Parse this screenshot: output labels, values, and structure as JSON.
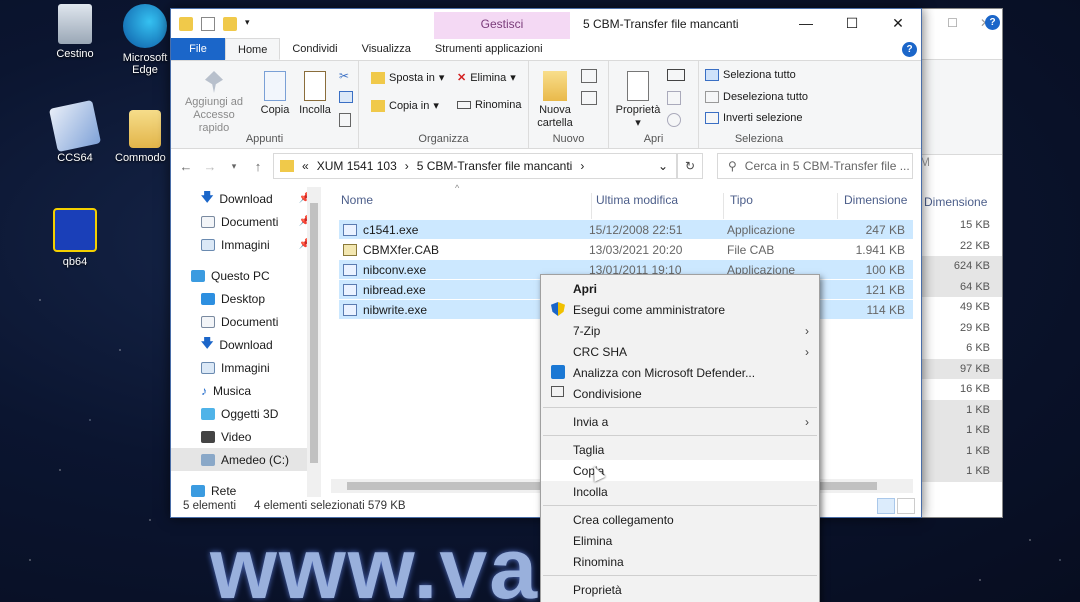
{
  "desktop": {
    "icons": [
      {
        "label": "Cestino"
      },
      {
        "label": "Microsoft Edge"
      },
      {
        "label": "CCS64"
      },
      {
        "label": "Commodo"
      },
      {
        "label": "qb64"
      }
    ],
    "watermark": "www.va          .it"
  },
  "window": {
    "title": "5 CBM-Transfer file mancanti",
    "context_tab": "Gestisci",
    "controls": {
      "minimize": "—",
      "maximize": "☐",
      "close": "✕"
    },
    "tabs": [
      "File",
      "Home",
      "Condividi",
      "Visualizza",
      "Strumenti applicazioni"
    ],
    "active_tab": "Home"
  },
  "ribbon": {
    "appunti": {
      "label": "Appunti",
      "pin": "Aggiungi ad Accesso rapido",
      "copy": "Copia",
      "paste": "Incolla"
    },
    "organizza": {
      "label": "Organizza",
      "move": "Sposta in",
      "copy_to": "Copia in",
      "delete": "Elimina",
      "rename": "Rinomina"
    },
    "nuovo": {
      "label": "Nuovo",
      "new_folder": "Nuova cartella"
    },
    "apri": {
      "label": "Apri",
      "properties": "Proprietà"
    },
    "seleziona": {
      "label": "Seleziona",
      "select_all": "Seleziona tutto",
      "deselect_all": "Deseleziona tutto",
      "invert": "Inverti selezione"
    }
  },
  "address": {
    "prefix": "«",
    "crumbs": [
      "XUM 1541 103",
      "5 CBM-Transfer file mancanti"
    ],
    "search_placeholder": "Cerca in 5 CBM-Transfer file ..."
  },
  "nav": {
    "items": [
      {
        "label": "Download",
        "pinned": true
      },
      {
        "label": "Documenti",
        "pinned": true
      },
      {
        "label": "Immagini",
        "pinned": true
      },
      {
        "label": "Questo PC"
      },
      {
        "label": "Desktop"
      },
      {
        "label": "Documenti"
      },
      {
        "label": "Download"
      },
      {
        "label": "Immagini"
      },
      {
        "label": "Musica"
      },
      {
        "label": "Oggetti 3D"
      },
      {
        "label": "Video"
      },
      {
        "label": "Amedeo (C:)"
      },
      {
        "label": "Rete"
      }
    ]
  },
  "columns": {
    "name": "Nome",
    "modified": "Ultima modifica",
    "type": "Tipo",
    "size": "Dimensione"
  },
  "files": [
    {
      "name": "c1541.exe",
      "modified": "15/12/2008 22:51",
      "type": "Applicazione",
      "size": "247 KB",
      "selected": true
    },
    {
      "name": "CBMXfer.CAB",
      "modified": "13/03/2021 20:20",
      "type": "File CAB",
      "size": "1.941 KB",
      "selected": false
    },
    {
      "name": "nibconv.exe",
      "modified": "13/01/2011 19:10",
      "type": "Applicazione",
      "size": "100 KB",
      "selected": true
    },
    {
      "name": "nibread.exe",
      "modified": "",
      "type": "",
      "size": "121 KB",
      "selected": true
    },
    {
      "name": "nibwrite.exe",
      "modified": "",
      "type": "",
      "size": "114 KB",
      "selected": true
    }
  ],
  "status": {
    "count": "5 elementi",
    "selection": "4 elementi selezionati  579 KB"
  },
  "context_menu": {
    "groups": [
      [
        {
          "label": "Apri",
          "bold": true
        },
        {
          "label": "Esegui come amministratore",
          "icon": "shield-icon"
        },
        {
          "label": "7-Zip",
          "submenu": true
        },
        {
          "label": "CRC SHA",
          "submenu": true
        },
        {
          "label": "Analizza con Microsoft Defender...",
          "icon": "defender-icon"
        },
        {
          "label": "Condivisione",
          "icon": "share-icon"
        }
      ],
      [
        {
          "label": "Invia a",
          "submenu": true
        }
      ],
      [
        {
          "label": "Taglia"
        },
        {
          "label": "Copia",
          "hover": true
        },
        {
          "label": "Incolla"
        }
      ],
      [
        {
          "label": "Crea collegamento"
        },
        {
          "label": "Elimina"
        },
        {
          "label": "Rinomina"
        }
      ],
      [
        {
          "label": "Proprietà"
        }
      ]
    ]
  },
  "background_window": {
    "column": "Dimensione",
    "search_fragment": "M",
    "sizes": [
      "15 KB",
      "22 KB",
      "624 KB",
      "64 KB",
      "49 KB",
      "29 KB",
      "6 KB",
      "97 KB",
      "16 KB",
      "1 KB",
      "1 KB",
      "1 KB",
      "1 KB"
    ]
  }
}
